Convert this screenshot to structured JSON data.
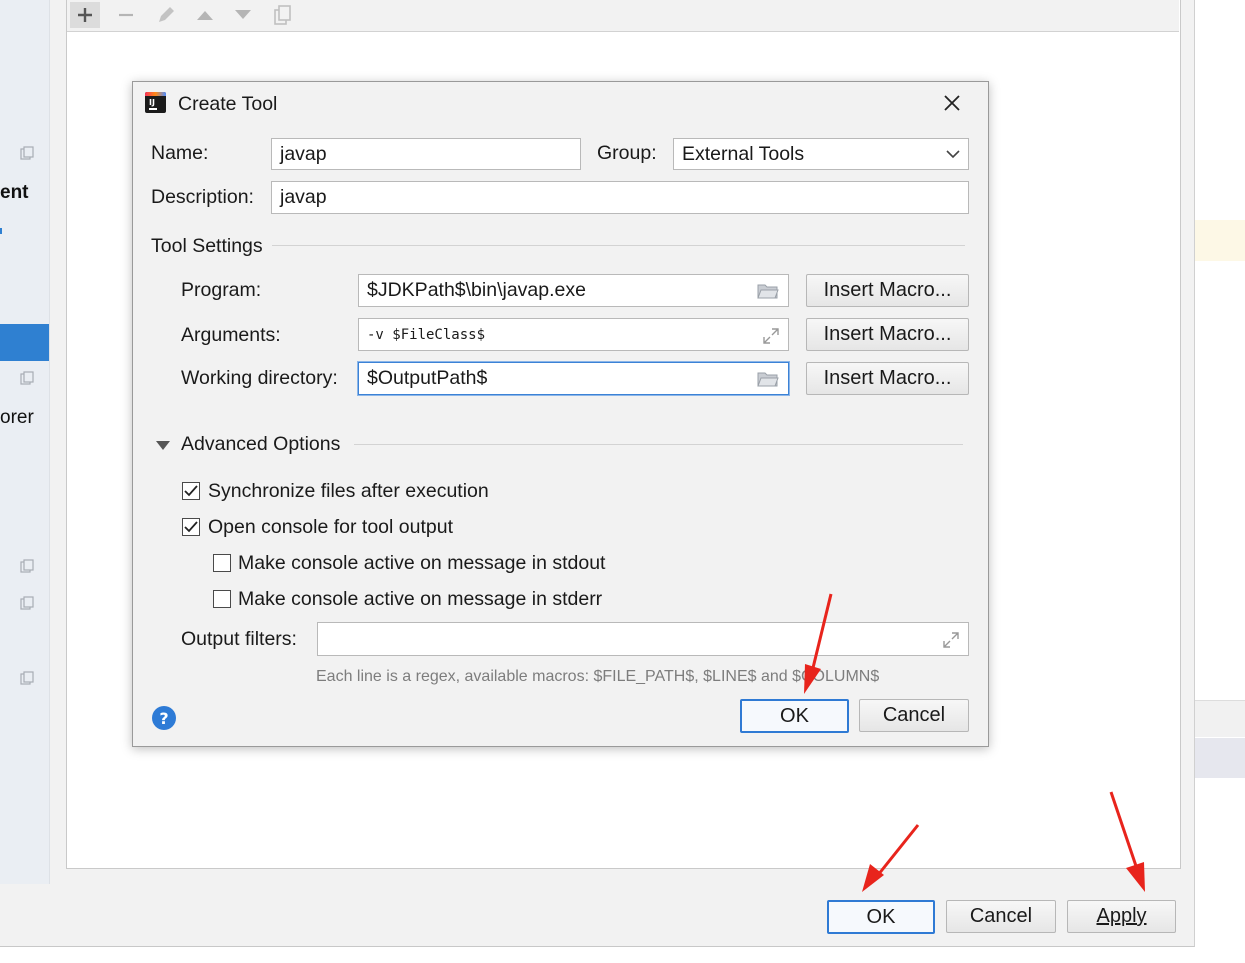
{
  "background": {
    "side_labels": [
      "ent",
      "orer"
    ],
    "toolbar_icons": [
      "add-icon",
      "remove-icon",
      "edit-icon",
      "move-up-icon",
      "move-down-icon",
      "copy-icon"
    ],
    "buttons": {
      "ok": "OK",
      "cancel": "Cancel",
      "apply": "Apply"
    }
  },
  "dialog": {
    "title": "Create Tool",
    "app_icon": "intellij-icon",
    "name_label": "Name:",
    "name_value": "javap",
    "group_label": "Group:",
    "group_value": "External Tools",
    "description_label": "Description:",
    "description_value": "javap",
    "tool_settings_title": "Tool Settings",
    "program_label": "Program:",
    "program_value": "$JDKPath$\\bin\\javap.exe",
    "arguments_label": "Arguments:",
    "arguments_value": "-v $FileClass$",
    "working_dir_label": "Working directory:",
    "working_dir_value": "$OutputPath$",
    "insert_macro_label": "Insert Macro...",
    "advanced_title": "Advanced Options",
    "sync_files_label": "Synchronize files after execution",
    "sync_files_checked": true,
    "open_console_label": "Open console for tool output",
    "open_console_checked": true,
    "stdout_label": "Make console active on message in stdout",
    "stdout_checked": false,
    "stderr_label": "Make console active on message in stderr",
    "stderr_checked": false,
    "output_filters_label": "Output filters:",
    "output_filters_value": "",
    "hint": "Each line is a regex, available macros: $FILE_PATH$, $LINE$ and $COLUMN$",
    "ok_label": "OK",
    "cancel_label": "Cancel",
    "help_label": "?"
  },
  "colors": {
    "accent": "#2f7ad4",
    "selection": "#2f80d1",
    "annotation_arrow": "#e8241c"
  }
}
